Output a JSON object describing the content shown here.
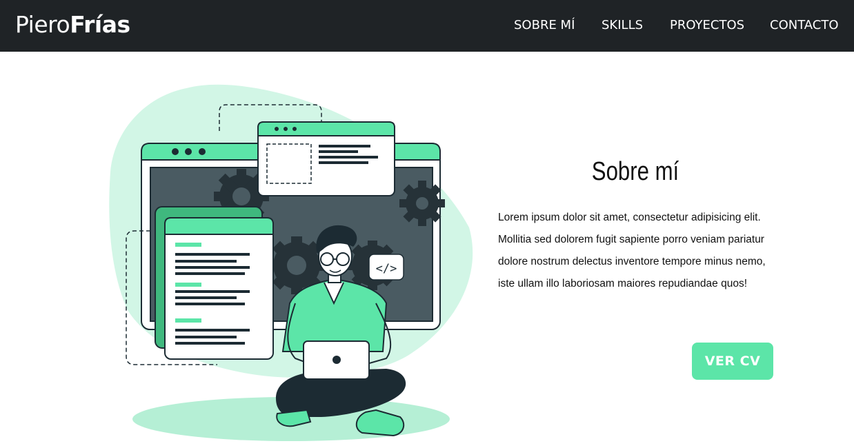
{
  "brand": {
    "first": "Piero",
    "last": "Frías"
  },
  "nav": {
    "items": [
      {
        "label": "SOBRE MÍ"
      },
      {
        "label": "SKILLS"
      },
      {
        "label": "PROYECTOS"
      },
      {
        "label": "CONTACTO"
      }
    ]
  },
  "about": {
    "title": "Sobre mí",
    "text": "Lorem ipsum dolor sit amet, consectetur adipisicing elit. Mollitia sed dolorem fugit sapiente porro veniam pariatur dolore nostrum delectus inventore tempore minus nemo, iste ullam illo laboriosam maiores repudiandae quos!",
    "button_label": "VER CV"
  },
  "illustration": {
    "code_tag": "</>"
  },
  "colors": {
    "navbar_bg": "#1f2326",
    "accent": "#5ce5a8",
    "blob": "#d2f6e6",
    "dark": "#1c2b33"
  }
}
